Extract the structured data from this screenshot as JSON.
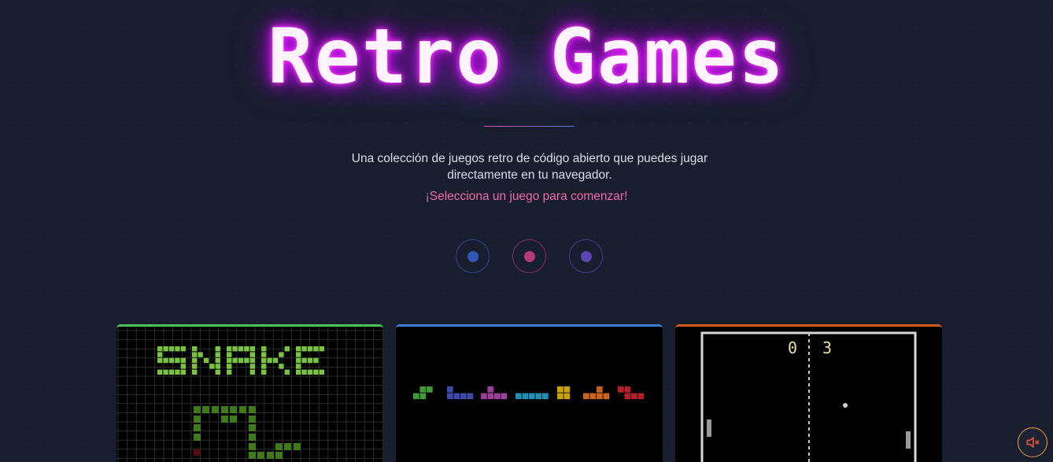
{
  "header": {
    "title": "Retro Games",
    "tagline": "Una colección de juegos retro de código abierto que puedes jugar directamente en tu navegador.",
    "cta": "¡Selecciona un juego para comenzar!"
  },
  "indicators": [
    {
      "color": "#3158b8",
      "ring": "#2c4a8f"
    },
    {
      "color": "#b33a78",
      "ring": "#8c2e60"
    },
    {
      "color": "#6045b5",
      "ring": "#4c3a8f"
    }
  ],
  "cards": [
    {
      "game": "snake",
      "accent": "#4ec15a",
      "art_text": "SNAKE"
    },
    {
      "game": "tetris",
      "accent": "#3d7dd1"
    },
    {
      "game": "pong",
      "accent": "#d15a18",
      "score_left": "0",
      "score_right": "3"
    }
  ],
  "sound": {
    "icon": "speaker-muted-icon",
    "color": "#e0573a"
  }
}
